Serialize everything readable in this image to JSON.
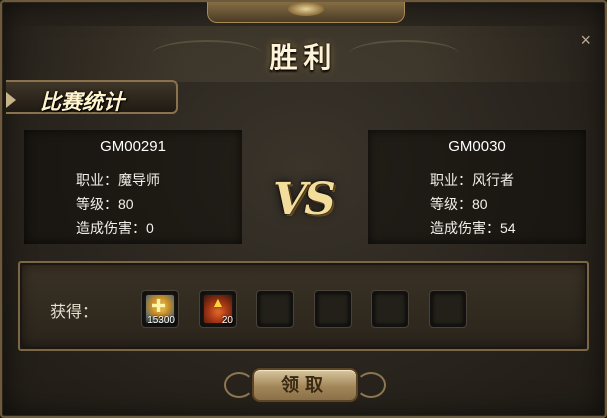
{
  "dialog": {
    "title": "胜利",
    "close_glyph": "×"
  },
  "section": {
    "label": "比赛统计"
  },
  "players": [
    {
      "name": "GM00291",
      "class_line": "职业：魔导师",
      "level_line": "等级：80",
      "damage_line": "造成伤害：0"
    },
    {
      "name": "GM0030",
      "class_line": "职业：风行者",
      "level_line": "等级：80",
      "damage_line": "造成伤害：54"
    }
  ],
  "vs_text": "VS",
  "rewards": {
    "label": "获得：",
    "items": [
      {
        "icon": "gold-coin-icon",
        "count": "15300"
      },
      {
        "icon": "fist-icon",
        "count": "20"
      }
    ],
    "empty_slots": 4
  },
  "claim_button": {
    "label": "领取"
  }
}
